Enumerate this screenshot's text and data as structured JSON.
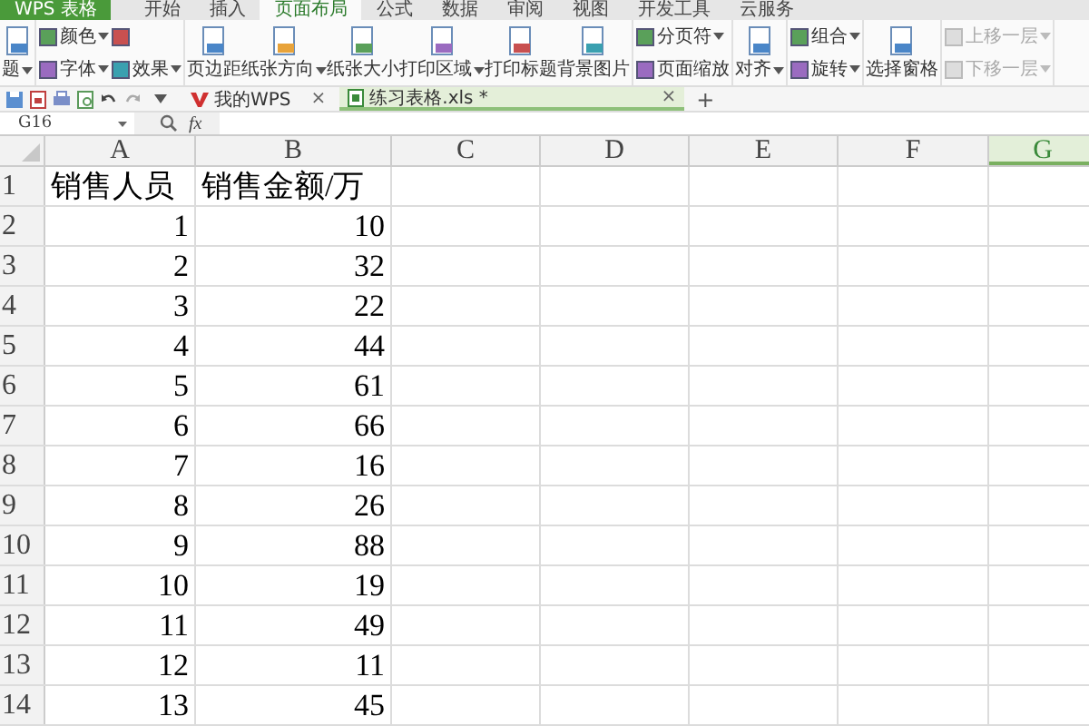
{
  "app_button": {
    "label": "WPS 表格"
  },
  "menu_tabs": [
    {
      "label": "开始",
      "selected": false
    },
    {
      "label": "插入",
      "selected": false
    },
    {
      "label": "页面布局",
      "selected": true
    },
    {
      "label": "公式",
      "selected": false
    },
    {
      "label": "数据",
      "selected": false
    },
    {
      "label": "审阅",
      "selected": false
    },
    {
      "label": "视图",
      "selected": false
    },
    {
      "label": "开发工具",
      "selected": false
    },
    {
      "label": "云服务",
      "selected": false
    }
  ],
  "ribbon": {
    "groups": [
      {
        "kind": "large",
        "items": [
          {
            "label": "题",
            "dropdown": true,
            "disabled": false
          }
        ]
      },
      {
        "kind": "small",
        "items": [
          {
            "label": "颜色",
            "dropdown": true,
            "disabled": false
          },
          {
            "label": "字体",
            "dropdown": true,
            "disabled": false
          },
          {
            "dropdown": false,
            "disabled": false
          },
          {
            "label": "效果",
            "dropdown": true,
            "disabled": false
          }
        ]
      },
      {
        "kind": "large",
        "items": [
          {
            "label": "页边距",
            "dropdown": false,
            "disabled": false
          },
          {
            "label": "纸张方向",
            "dropdown": true,
            "disabled": false
          },
          {
            "label": "纸张大小",
            "dropdown": false,
            "disabled": false
          },
          {
            "label": "打印区域",
            "dropdown": true,
            "disabled": false
          },
          {
            "label": "打印标题",
            "dropdown": false,
            "disabled": false
          },
          {
            "label": "背景图片",
            "dropdown": false,
            "disabled": false
          }
        ]
      },
      {
        "kind": "small",
        "items": [
          {
            "label": "分页符",
            "dropdown": true,
            "disabled": false
          },
          {
            "label": "页面缩放",
            "dropdown": false,
            "disabled": false
          }
        ]
      },
      {
        "kind": "large",
        "items": [
          {
            "label": "对齐",
            "dropdown": true,
            "disabled": false
          }
        ]
      },
      {
        "kind": "small",
        "items": [
          {
            "label": "组合",
            "dropdown": true,
            "disabled": false
          },
          {
            "label": "旋转",
            "dropdown": true,
            "disabled": false
          }
        ]
      },
      {
        "kind": "large",
        "items": [
          {
            "label": "选择窗格",
            "dropdown": false,
            "disabled": false
          }
        ]
      },
      {
        "kind": "small",
        "items": [
          {
            "label": "上移一层",
            "dropdown": true,
            "disabled": true
          },
          {
            "label": "下移一层",
            "dropdown": true,
            "disabled": true
          }
        ]
      }
    ]
  },
  "doc_tabs": [
    {
      "label": "我的WPS",
      "selected": false,
      "close": "×"
    },
    {
      "label": "练习表格.xls *",
      "selected": true,
      "close": "×"
    }
  ],
  "new_tab": "+",
  "formula_bar": {
    "cell_ref": "G16",
    "fx": "fx"
  },
  "sheet": {
    "columns": [
      {
        "label": "A",
        "selected": false
      },
      {
        "label": "B",
        "selected": false
      },
      {
        "label": "C",
        "selected": false
      },
      {
        "label": "D",
        "selected": false
      },
      {
        "label": "E",
        "selected": false
      },
      {
        "label": "F",
        "selected": false
      },
      {
        "label": "G",
        "selected": true
      }
    ],
    "rows": [
      {
        "number": "1",
        "cells": [
          "销售人员",
          "销售金额/万"
        ]
      },
      {
        "number": "2",
        "cells": [
          "1",
          "10"
        ]
      },
      {
        "number": "3",
        "cells": [
          "2",
          "32"
        ]
      },
      {
        "number": "4",
        "cells": [
          "3",
          "22"
        ]
      },
      {
        "number": "5",
        "cells": [
          "4",
          "44"
        ]
      },
      {
        "number": "6",
        "cells": [
          "5",
          "61"
        ]
      },
      {
        "number": "7",
        "cells": [
          "6",
          "66"
        ]
      },
      {
        "number": "8",
        "cells": [
          "7",
          "16"
        ]
      },
      {
        "number": "9",
        "cells": [
          "8",
          "26"
        ]
      },
      {
        "number": "10",
        "cells": [
          "9",
          "88"
        ]
      },
      {
        "number": "11",
        "cells": [
          "10",
          "19"
        ]
      },
      {
        "number": "12",
        "cells": [
          "11",
          "49"
        ]
      },
      {
        "number": "13",
        "cells": [
          "12",
          "11"
        ]
      },
      {
        "number": "14",
        "cells": [
          "13",
          "45"
        ]
      }
    ]
  }
}
